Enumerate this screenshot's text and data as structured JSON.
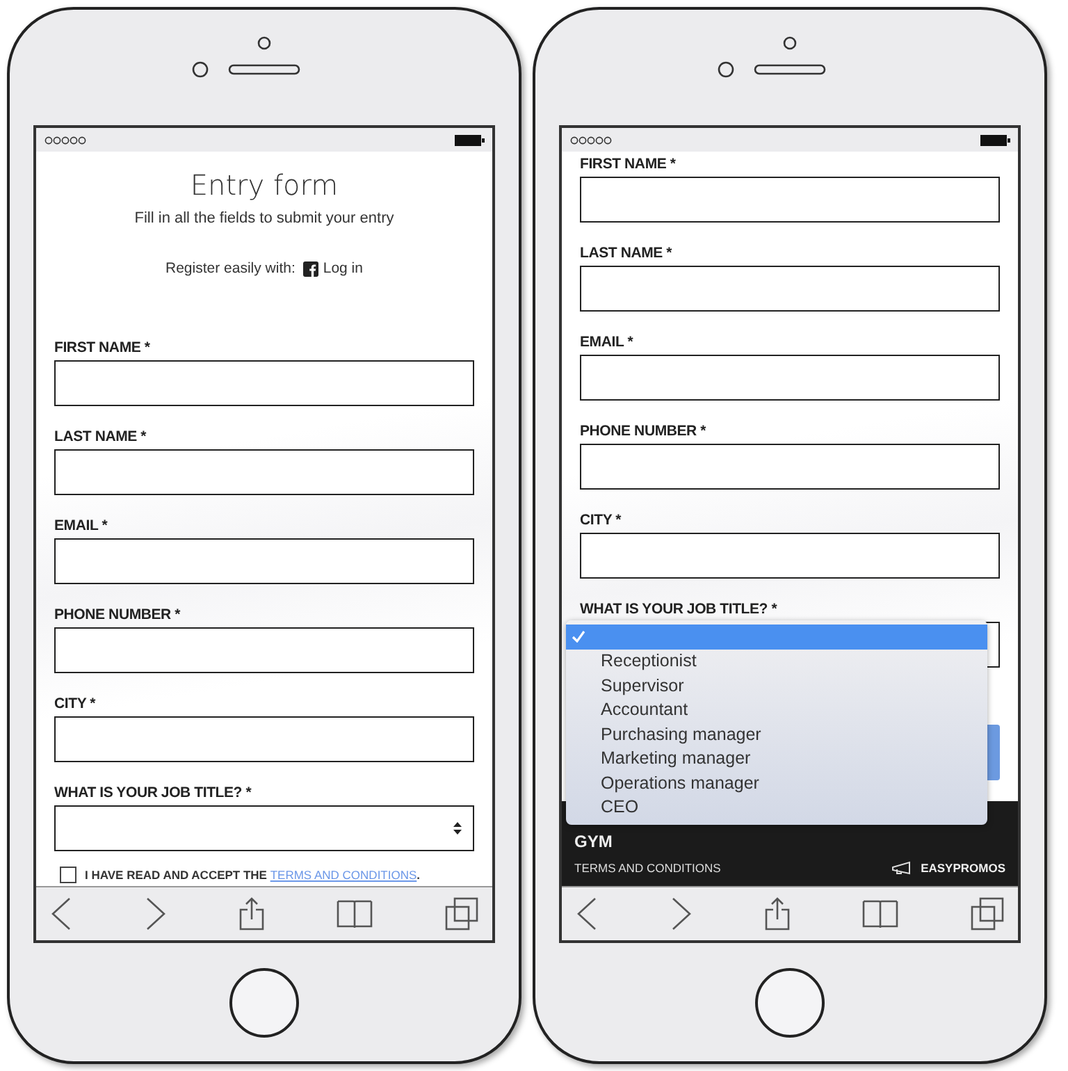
{
  "phones": [
    {
      "header": {
        "title": "Entry form",
        "subtitle": "Fill in all the fields to submit your entry",
        "register_label": "Register easily with:",
        "login_link": "Log in"
      },
      "fields": [
        {
          "label": "FIRST NAME *",
          "kind": "text"
        },
        {
          "label": "LAST NAME *",
          "kind": "text"
        },
        {
          "label": "EMAIL *",
          "kind": "text"
        },
        {
          "label": "PHONE NUMBER *",
          "kind": "text"
        },
        {
          "label": "CITY *",
          "kind": "text"
        },
        {
          "label": "WHAT IS YOUR JOB TITLE? *",
          "kind": "select"
        }
      ],
      "consent": {
        "checked": false,
        "text": "I HAVE READ AND ACCEPT THE ",
        "link": "TERMS AND CONDITIONS",
        "after": "."
      }
    },
    {
      "fields": [
        {
          "label": "FIRST NAME *",
          "kind": "text"
        },
        {
          "label": "LAST NAME *",
          "kind": "text"
        },
        {
          "label": "EMAIL *",
          "kind": "text"
        },
        {
          "label": "PHONE NUMBER *",
          "kind": "text"
        },
        {
          "label": "CITY *",
          "kind": "text"
        },
        {
          "label": "WHAT IS YOUR JOB TITLE? *",
          "kind": "select"
        }
      ],
      "dropdown": {
        "options": [
          {
            "selected": true
          },
          {
            "label": "Receptionist",
            "selected": false
          },
          {
            "label": "Supervisor",
            "selected": false
          },
          {
            "label": "Accountant",
            "selected": false
          },
          {
            "label": "Purchasing manager",
            "selected": false
          },
          {
            "label": "Marketing manager",
            "selected": false
          },
          {
            "label": "Operations manager",
            "selected": false
          },
          {
            "label": "CEO",
            "selected": false
          }
        ]
      },
      "footer": {
        "brand": "GYM",
        "terms_link": "TERMS AND CONDITIONS",
        "logo_text": "EASYPROMOS"
      }
    }
  ]
}
